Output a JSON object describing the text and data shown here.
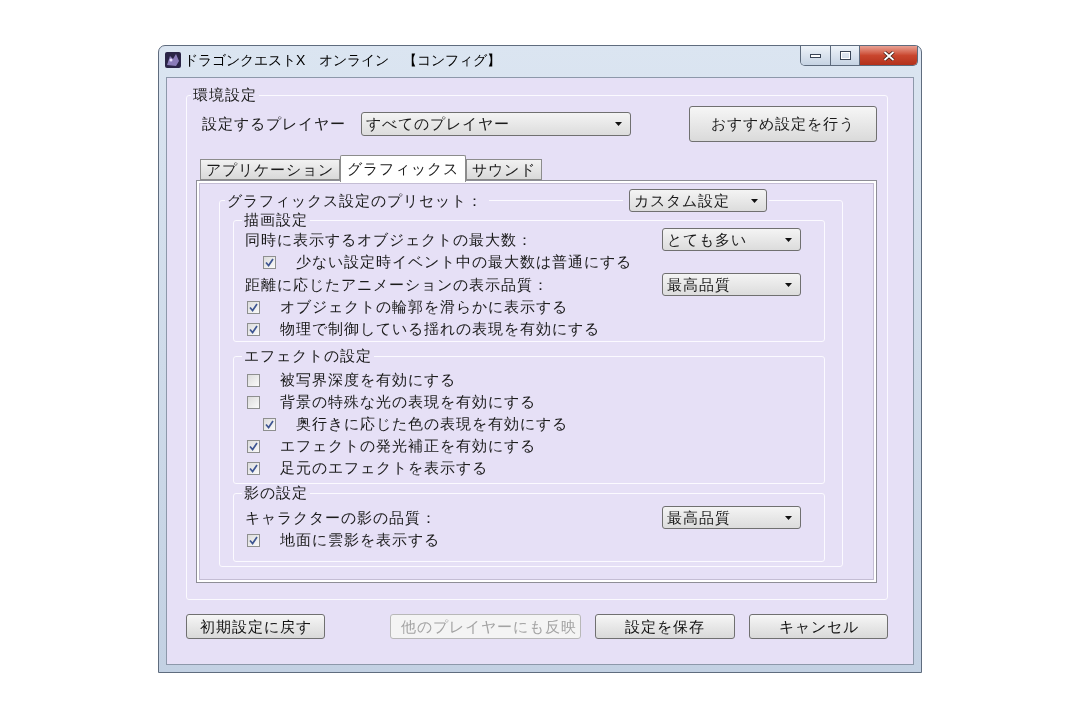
{
  "window": {
    "title": "ドラゴンクエストX　オンライン　【コンフィグ】"
  },
  "environment": {
    "title": "環境設定",
    "player_label": "設定するプレイヤー",
    "player_select": "すべてのプレイヤー",
    "recommend_button": "おすすめ設定を行う"
  },
  "tabs": [
    {
      "label": "アプリケーション",
      "selected": false
    },
    {
      "label": "グラフィックス",
      "selected": true
    },
    {
      "label": "サウンド",
      "selected": false
    }
  ],
  "preset": {
    "label": "グラフィックス設定のプリセット：",
    "value": "カスタム設定"
  },
  "groups": [
    {
      "title": "描画設定",
      "items": [
        {
          "kind": "select",
          "label": "同時に表示するオブジェクトの最大数：",
          "value": "とても多い",
          "children": [
            {
              "kind": "checkbox",
              "label": "少ない設定時イベント中の最大数は普通にする",
              "checked": true
            }
          ]
        },
        {
          "kind": "select",
          "label": "距離に応じたアニメーションの表示品質：",
          "value": "最高品質"
        },
        {
          "kind": "checkbox",
          "label": "オブジェクトの輪郭を滑らかに表示する",
          "checked": true
        },
        {
          "kind": "checkbox",
          "label": "物理で制御している揺れの表現を有効にする",
          "checked": true
        }
      ]
    },
    {
      "title": "エフェクトの設定",
      "items": [
        {
          "kind": "checkbox",
          "label": "被写界深度を有効にする",
          "checked": false
        },
        {
          "kind": "checkbox",
          "label": "背景の特殊な光の表現を有効にする",
          "checked": false,
          "children": [
            {
              "kind": "checkbox",
              "label": "奥行きに応じた色の表現を有効にする",
              "checked": true
            }
          ]
        },
        {
          "kind": "checkbox",
          "label": "エフェクトの発光補正を有効にする",
          "checked": true
        },
        {
          "kind": "checkbox",
          "label": "足元のエフェクトを表示する",
          "checked": true
        }
      ]
    },
    {
      "title": "影の設定",
      "items": [
        {
          "kind": "select",
          "label": "キャラクターの影の品質：",
          "value": "最高品質"
        },
        {
          "kind": "checkbox",
          "label": "地面に雲影を表示する",
          "checked": true
        }
      ]
    }
  ],
  "buttons": [
    {
      "label": "初期設定に戻す",
      "disabled": false
    },
    {
      "label": "他のプレイヤーにも反映",
      "disabled": true
    },
    {
      "label": "設定を保存",
      "disabled": false
    },
    {
      "label": "キャンセル",
      "disabled": false
    }
  ]
}
